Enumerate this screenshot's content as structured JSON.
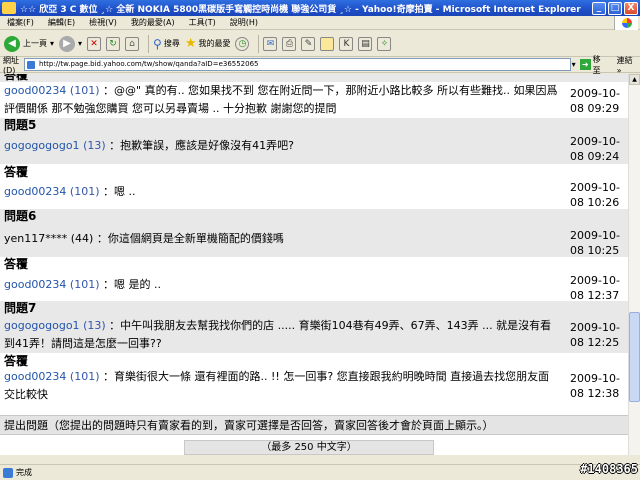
{
  "window": {
    "title": "☆☆ 欣亞 3 C 數位 ¸☆ 全新 NOKIA 5800黑碳版手寫觸控時尚機 聯強公司貨 ¸☆ - Yahoo!奇摩拍賣 - Microsoft Internet Explorer",
    "min": "_",
    "max": "□",
    "close": "X"
  },
  "menu": [
    "檔案(F)",
    "編輯(E)",
    "檢視(V)",
    "我的最愛(A)",
    "工具(T)",
    "說明(H)"
  ],
  "toolbar": {
    "back": "上一頁",
    "search": "搜尋",
    "favorites": "我的最愛"
  },
  "address": {
    "label": "網址(D)",
    "url": "http://tw.page.bid.yahoo.com/tw/show/qanda?aID=e36552065",
    "go": "移至",
    "links": "連結 »"
  },
  "content": {
    "rows": [
      {
        "kind": "heading",
        "label": "答覆"
      },
      {
        "kind": "msg",
        "user": "good00234",
        "score": "(101)",
        "text": "：@@\" 真的有.. 您如果找不到 您在附近問一下，那附近小路比較多 所以有些難找.. 如果因爲評價關係 那不勉強您購買 您可以另尋賣場 .. 十分抱歉 謝謝您的提問",
        "time": "2009-10-08 09:29"
      },
      {
        "kind": "heading",
        "label": "問題5"
      },
      {
        "kind": "msg",
        "user": "gogogogogo1",
        "score": "(13)",
        "text": "：抱歉筆誤，應該是好像沒有41弄吧?",
        "time": "2009-10-08 09:24"
      },
      {
        "kind": "heading",
        "label": "答覆"
      },
      {
        "kind": "msg",
        "user": "good00234",
        "score": "(101)",
        "text": "：嗯 ..",
        "time": "2009-10-08 10:26"
      },
      {
        "kind": "heading",
        "label": "問題6"
      },
      {
        "kind": "msg",
        "user": "yen117****",
        "score": "(44)",
        "text": "：你這個網頁是全新單機簡配的價錢嗎",
        "time": "2009-10-08 10:25"
      },
      {
        "kind": "heading",
        "label": "答覆"
      },
      {
        "kind": "msg",
        "user": "good00234",
        "score": "(101)",
        "text": "：嗯 是的 ..",
        "time": "2009-10-08 12:37"
      },
      {
        "kind": "heading",
        "label": "問題7"
      },
      {
        "kind": "msg",
        "user": "gogogogogo1",
        "score": "(13)",
        "text": "：中午叫我朋友去幫我找你們的店 ..... 育樂街104巷有49弄、67弄、143弄 ... 就是沒有看到41弄！請問這是怎麼一回事??",
        "time": "2009-10-08 12:25"
      },
      {
        "kind": "heading",
        "label": "答覆"
      },
      {
        "kind": "msg",
        "user": "good00234",
        "score": "(101)",
        "text": "：育樂街很大一條 還有裡面的路.. !! 怎一回事? 您直接跟我約明晚時間 直接過去找您朋友面交比較快",
        "time": "2009-10-08 12:38"
      }
    ],
    "ask_text": "提出問題（您提出的問題時只有賣家看的到，賣家可選擇是否回答，賣家回答後才會於頁面上顯示。）",
    "limit_text": "（最多 250 中文字）"
  },
  "status": {
    "text": "完成",
    "watermark": "#1408365"
  }
}
